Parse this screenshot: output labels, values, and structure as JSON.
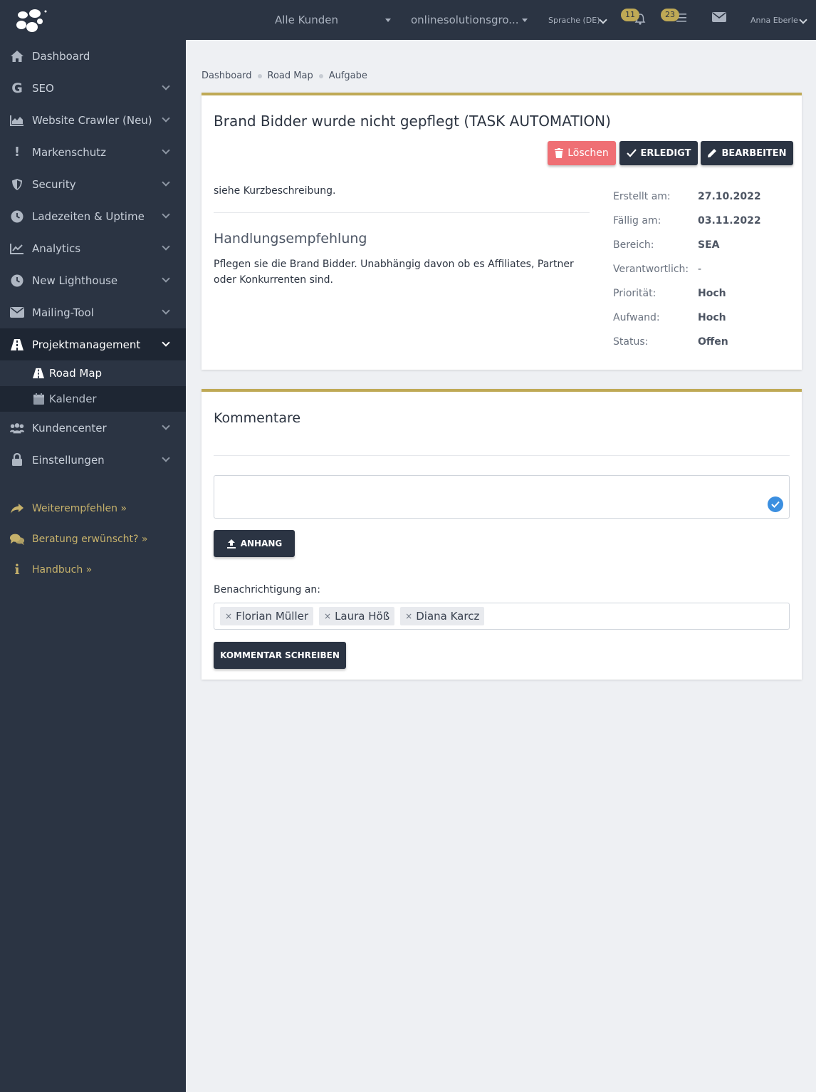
{
  "topbar": {
    "customer_select": "Alle Kunden",
    "project_select": "onlinesolutionsgro...",
    "language": "Sprache (DE)",
    "notifications_count": "11",
    "tasks_count": "23",
    "user_name": "Anna Eberle"
  },
  "sidebar": {
    "items": [
      {
        "label": "Dashboard",
        "icon": "home-icon"
      },
      {
        "label": "SEO",
        "icon": "google-icon"
      },
      {
        "label": "Website Crawler (Neu)",
        "icon": "area-chart-icon"
      },
      {
        "label": "Markenschutz",
        "icon": "exclamation-icon"
      },
      {
        "label": "Security",
        "icon": "shield-icon"
      },
      {
        "label": "Ladezeiten & Uptime",
        "icon": "clock-icon"
      },
      {
        "label": "Analytics",
        "icon": "line-chart-icon"
      },
      {
        "label": "New Lighthouse",
        "icon": "clock-icon"
      },
      {
        "label": "Mailing-Tool",
        "icon": "envelope-icon"
      },
      {
        "label": "Projektmanagement",
        "icon": "road-icon"
      }
    ],
    "sub_items": [
      {
        "label": "Road Map",
        "icon": "road-icon"
      },
      {
        "label": "Kalender",
        "icon": "calendar-icon"
      }
    ],
    "items_after": [
      {
        "label": "Kundencenter",
        "icon": "users-icon"
      },
      {
        "label": "Einstellungen",
        "icon": "lock-icon"
      }
    ],
    "extra_links": [
      {
        "label": "Weiterempfehlen »",
        "icon": "share-icon"
      },
      {
        "label": "Beratung erwünscht? »",
        "icon": "comments-icon"
      },
      {
        "label": "Handbuch »",
        "icon": "info-icon"
      }
    ]
  },
  "breadcrumb": [
    "Dashboard",
    "Road Map",
    "Aufgabe"
  ],
  "task": {
    "title": "Brand Bidder wurde nicht gepflegt (TASK AUTOMATION)",
    "delete_label": "Löschen",
    "done_label": "ERLEDIGT",
    "edit_label": "BEARBEITEN",
    "description": "siehe Kurzbeschreibung.",
    "recommendation_title": "Handlungsempfehlung",
    "recommendation_text": "Pflegen sie die Brand Bidder. Unabhängig davon ob es Affiliates, Partner oder Konkurrenten sind.",
    "meta": [
      {
        "label": "Erstellt am:",
        "value": "27.10.2022"
      },
      {
        "label": "Fällig am:",
        "value": "03.11.2022"
      },
      {
        "label": "Bereich:",
        "value": "SEA"
      },
      {
        "label": "Verantwortlich:",
        "value": "-"
      },
      {
        "label": "Priorität:",
        "value": "Hoch"
      },
      {
        "label": "Aufwand:",
        "value": "Hoch"
      },
      {
        "label": "Status:",
        "value": "Offen"
      }
    ]
  },
  "comments": {
    "title": "Kommentare",
    "attach_label": "ANHANG",
    "notify_label": "Benachrichtigung an:",
    "recipients": [
      "Florian Müller",
      "Laura Höß",
      "Diana Karcz"
    ],
    "submit_label": "KOMMENTAR SCHREIBEN"
  },
  "colors": {
    "sidebar_bg": "#2b3443",
    "accent_gold": "#bfa955",
    "danger": "#ef6f74",
    "link_gold": "#c6b16b"
  }
}
